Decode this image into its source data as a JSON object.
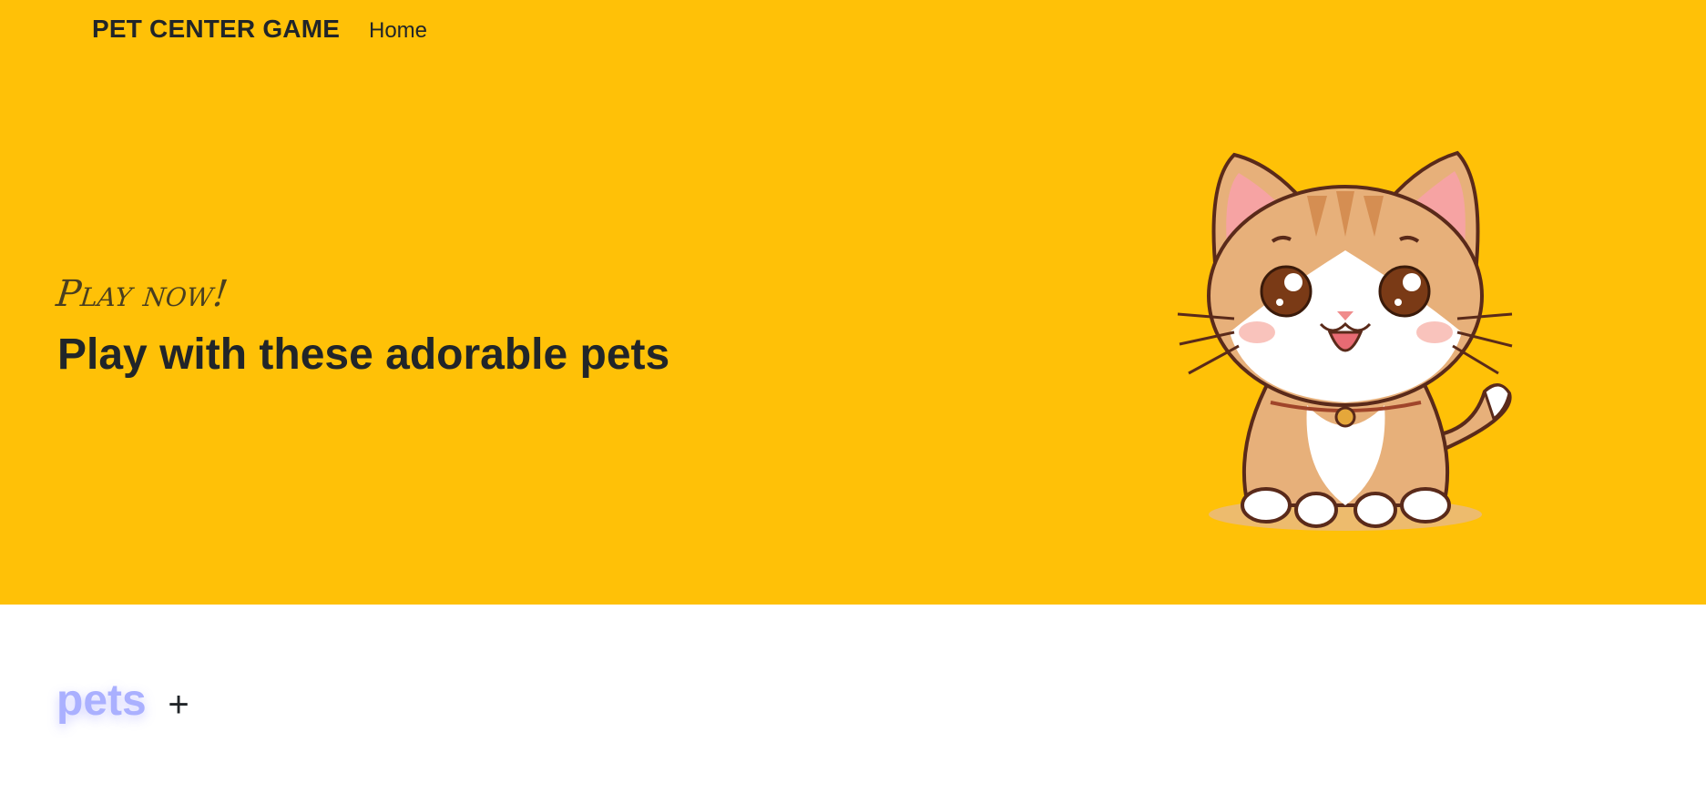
{
  "navbar": {
    "brand": "PET CENTER GAME",
    "links": [
      {
        "label": "Home"
      }
    ]
  },
  "hero": {
    "kicker": "Play now!",
    "headline": "Play with these adorable pets",
    "background_color": "#ffc107",
    "illustration": "cartoon-cat"
  },
  "pets_section": {
    "title": "pets",
    "add_label": "+",
    "title_color": "#aab0ff"
  }
}
